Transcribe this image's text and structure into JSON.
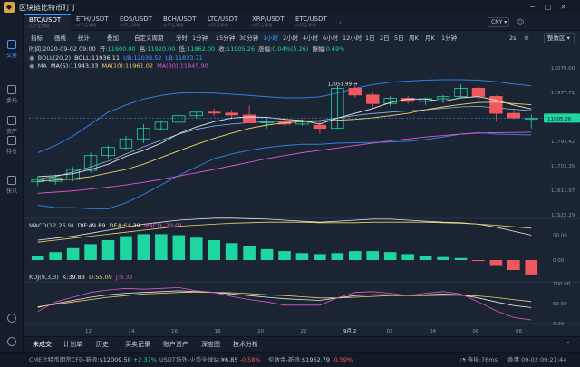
{
  "app": {
    "title": "区块链比特币盯丁"
  },
  "window_controls": [
    "−",
    "□",
    "×"
  ],
  "sidebar": {
    "items": [
      {
        "label": "交易",
        "icon": "chart-icon",
        "active": true
      },
      {
        "label": "委托",
        "icon": "order-icon",
        "active": false
      },
      {
        "label": "资产",
        "icon": "wallet-icon",
        "active": false
      },
      {
        "label": "持仓",
        "icon": "position-icon",
        "active": false
      },
      {
        "label": "快讯",
        "icon": "news-icon",
        "active": false
      }
    ]
  },
  "tabs": [
    {
      "name": "BTC/USDT",
      "sub": "火币全球站",
      "active": true
    },
    {
      "name": "ETH/USDT",
      "sub": "火币全球站",
      "active": false
    },
    {
      "name": "EOS/USDT",
      "sub": "火币全球站",
      "active": false
    },
    {
      "name": "BCH/USDT",
      "sub": "火币全球站",
      "active": false
    },
    {
      "name": "LTC/USDT",
      "sub": "火币全球站",
      "active": false
    },
    {
      "name": "XRP/USDT",
      "sub": "火币全球站",
      "active": false
    },
    {
      "name": "ETC/USDT",
      "sub": "火币全球站",
      "active": false
    }
  ],
  "currency": "CNY ▾",
  "toolbar": {
    "items": [
      "指标",
      "画线",
      "统计",
      "叠加",
      "自定义周期",
      "分时",
      "1分钟",
      "15分钟",
      "30分钟",
      "1小时",
      "2小时",
      "4小时",
      "6小时",
      "12小时",
      "1日",
      "2日",
      "5日",
      "周K",
      "月K",
      "1分钟"
    ],
    "active": "1小时",
    "dropdown": "整数区 ▾",
    "scale": "2s"
  },
  "info": {
    "time": "时间:2020-09-02 09:00",
    "open_label": "开:",
    "open": "11900.00",
    "high_label": "高:",
    "high": "11920.00",
    "low_label": "低:",
    "low": "11862.00",
    "close_label": "收:",
    "close": "11905.26",
    "change_label": "涨幅:",
    "change": "0.04%(5.26)",
    "amp_label": "振幅:",
    "amp": "0.49%"
  },
  "boll": {
    "label": "BOLL(20,2)",
    "boll": "BOLL:11936.11",
    "ub": "UB:12038.52",
    "lb": "LB:11833.71"
  },
  "ma": {
    "label": "MA",
    "ma5": "MA(5):11943.33",
    "ma10": "MA(10):11961.02",
    "ma30": "MA(30):11845.90"
  },
  "macd": {
    "label": "MACD(12,26,9)",
    "dif": "DIF:49.89",
    "dea": "DEA:64.39",
    "macd": "MACD:-29.01"
  },
  "kdj": {
    "label": "KDJ(9,3,3)",
    "k": "K:39.83",
    "d": "D:55.09",
    "j": "J:9.32"
  },
  "colors": {
    "up": "#1fd6a0",
    "down": "#f0585f",
    "accent": "#3d9bff",
    "bg": "#1b2433"
  },
  "chart_data": {
    "type": "candlestick",
    "price_ticks": [
      "12070.00",
      "11977.71",
      "11885.43",
      "11793.42",
      "11702.35",
      "11611.97",
      "11522.29"
    ],
    "current_price": "11905.26",
    "max_label": "12051.99",
    "x_ticks": [
      "12",
      "14",
      "16",
      "18",
      "20",
      "22",
      "9月 2",
      "02",
      "04",
      "06",
      "08"
    ],
    "macd_ticks": [
      "50.00",
      "0.00"
    ],
    "kdj_ticks": [
      "100.00",
      "50.00",
      "0.00"
    ],
    "candles": [
      {
        "o": 11638,
        "h": 11660,
        "l": 11620,
        "c": 11647
      },
      {
        "o": 11640,
        "h": 11668,
        "l": 11626,
        "c": 11655
      },
      {
        "o": 11648,
        "h": 11700,
        "l": 11640,
        "c": 11690
      },
      {
        "o": 11686,
        "h": 11760,
        "l": 11675,
        "c": 11748
      },
      {
        "o": 11748,
        "h": 11790,
        "l": 11736,
        "c": 11782
      },
      {
        "o": 11780,
        "h": 11830,
        "l": 11770,
        "c": 11818
      },
      {
        "o": 11818,
        "h": 11880,
        "l": 11800,
        "c": 11862
      },
      {
        "o": 11860,
        "h": 11896,
        "l": 11852,
        "c": 11888
      },
      {
        "o": 11888,
        "h": 11925,
        "l": 11880,
        "c": 11915
      },
      {
        "o": 11915,
        "h": 11936,
        "l": 11902,
        "c": 11930
      },
      {
        "o": 11930,
        "h": 11945,
        "l": 11914,
        "c": 11926
      },
      {
        "o": 11926,
        "h": 11940,
        "l": 11900,
        "c": 11918
      },
      {
        "o": 11918,
        "h": 11960,
        "l": 11890,
        "c": 11885
      },
      {
        "o": 11885,
        "h": 11905,
        "l": 11862,
        "c": 11892
      },
      {
        "o": 11892,
        "h": 11908,
        "l": 11872,
        "c": 11880
      },
      {
        "o": 11880,
        "h": 11900,
        "l": 11872,
        "c": 11894
      },
      {
        "o": 11875,
        "h": 11892,
        "l": 11840,
        "c": 11862
      },
      {
        "o": 11862,
        "h": 12040,
        "l": 11860,
        "c": 12030
      },
      {
        "o": 12030,
        "h": 12052,
        "l": 11992,
        "c": 12002
      },
      {
        "o": 12002,
        "h": 12014,
        "l": 11950,
        "c": 11966
      },
      {
        "o": 11966,
        "h": 11998,
        "l": 11955,
        "c": 11988
      },
      {
        "o": 11988,
        "h": 11998,
        "l": 11965,
        "c": 11975
      },
      {
        "o": 11975,
        "h": 11992,
        "l": 11960,
        "c": 11986
      },
      {
        "o": 11986,
        "h": 12002,
        "l": 11970,
        "c": 11995
      },
      {
        "o": 11996,
        "h": 12048,
        "l": 11990,
        "c": 12030
      },
      {
        "o": 12030,
        "h": 12040,
        "l": 11982,
        "c": 11996
      },
      {
        "o": 11996,
        "h": 12000,
        "l": 11890,
        "c": 11925
      },
      {
        "o": 11925,
        "h": 11945,
        "l": 11900,
        "c": 11906
      },
      {
        "o": 11900,
        "h": 11920,
        "l": 11862,
        "c": 11905
      }
    ],
    "boll_up": [
      11760,
      11790,
      11830,
      11880,
      11930,
      11960,
      11985,
      12000,
      12010,
      12012,
      12010,
      12005,
      12000,
      11995,
      11990,
      11990,
      11994,
      12010,
      12030,
      12045,
      12055,
      12060,
      12064,
      12066,
      12066,
      12064,
      12058,
      12048,
      12040
    ],
    "boll_mid": [
      11650,
      11660,
      11680,
      11700,
      11725,
      11755,
      11785,
      11812,
      11838,
      11858,
      11872,
      11880,
      11886,
      11890,
      11892,
      11893,
      11895,
      11905,
      11916,
      11924,
      11930,
      11935,
      11940,
      11946,
      11952,
      11954,
      11948,
      11942,
      11936
    ],
    "boll_low": [
      11540,
      11530,
      11530,
      11525,
      11525,
      11550,
      11585,
      11625,
      11665,
      11700,
      11735,
      11755,
      11770,
      11782,
      11790,
      11795,
      11795,
      11800,
      11802,
      11803,
      11805,
      11808,
      11815,
      11826,
      11838,
      11844,
      11838,
      11836,
      11834
    ],
    "ma_series": [
      {
        "name": "MA(5)",
        "color": "#e7e7e7",
        "values": [
          11660,
          11664,
          11672,
          11690,
          11712,
          11745,
          11770,
          11800,
          11840,
          11868,
          11890,
          11905,
          11910,
          11908,
          11900,
          11895,
          11880,
          11905,
          11925,
          11945,
          11970,
          11985,
          11985,
          11975,
          11990,
          11995,
          11980,
          11960,
          11943
        ]
      },
      {
        "name": "MA(10)",
        "color": "#f1d36a",
        "values": [
          11640,
          11645,
          11650,
          11660,
          11675,
          11690,
          11712,
          11740,
          11768,
          11795,
          11820,
          11842,
          11862,
          11876,
          11885,
          11890,
          11892,
          11896,
          11900,
          11906,
          11915,
          11925,
          11940,
          11952,
          11962,
          11970,
          11972,
          11966,
          11961
        ]
      },
      {
        "name": "MA(30)",
        "color": "#e058c9",
        "values": [
          11590,
          11595,
          11600,
          11608,
          11616,
          11625,
          11636,
          11648,
          11662,
          11676,
          11690,
          11705,
          11720,
          11735,
          11748,
          11760,
          11770,
          11780,
          11790,
          11800,
          11810,
          11818,
          11826,
          11832,
          11838,
          11842,
          11844,
          11845,
          11846
        ]
      }
    ],
    "macd_hist": [
      8,
      16,
      24,
      32,
      40,
      48,
      52,
      52,
      50,
      45,
      40,
      34,
      28,
      22,
      18,
      14,
      12,
      14,
      18,
      18,
      16,
      12,
      8,
      6,
      4,
      -2,
      -10,
      -20,
      -29
    ],
    "macd_dif": [
      40,
      44,
      48,
      54,
      60,
      66,
      72,
      76,
      80,
      82,
      84,
      84,
      83,
      82,
      80,
      78,
      76,
      78,
      80,
      82,
      82,
      80,
      78,
      76,
      75,
      72,
      66,
      58,
      50
    ],
    "macd_dea": [
      36,
      40,
      44,
      48,
      52,
      56,
      60,
      64,
      68,
      70,
      72,
      74,
      75,
      76,
      76,
      76,
      75,
      75,
      75,
      76,
      76,
      76,
      76,
      75,
      74,
      72,
      70,
      67,
      64
    ],
    "kdj_k": [
      40,
      50,
      58,
      66,
      72,
      76,
      78,
      80,
      82,
      80,
      78,
      74,
      70,
      66,
      62,
      60,
      58,
      64,
      70,
      72,
      72,
      70,
      72,
      74,
      72,
      64,
      54,
      45,
      40
    ],
    "kdj_d": [
      42,
      48,
      54,
      60,
      66,
      70,
      74,
      76,
      78,
      79,
      78,
      77,
      75,
      72,
      70,
      67,
      64,
      64,
      66,
      68,
      70,
      70,
      70,
      71,
      71,
      69,
      65,
      60,
      55
    ],
    "kdj_j": [
      30,
      54,
      66,
      78,
      84,
      88,
      86,
      88,
      90,
      82,
      78,
      68,
      60,
      54,
      46,
      46,
      46,
      64,
      78,
      80,
      76,
      70,
      76,
      80,
      74,
      54,
      32,
      15,
      9
    ]
  },
  "bottom_tabs": [
    "未成交",
    "计划单",
    "历史",
    "买卖记录",
    "账户资产",
    "深度图",
    "技术分析"
  ],
  "status": {
    "item1_label": "CME比特币期货CFD-新浪:",
    "item1_value": "$12009.50",
    "item1_change": "+2.37%",
    "item2_label": "USDT场外-火币全球站:",
    "item2_value": "¥6.85",
    "item2_change": "-0.58%",
    "item3_label": "伦敦金-新浪:",
    "item3_value": "$1962.79",
    "item3_change": "-0.59%",
    "link_label": "连接:",
    "latency": "76ms",
    "datetime": "香港 09-02 09:21:44"
  }
}
